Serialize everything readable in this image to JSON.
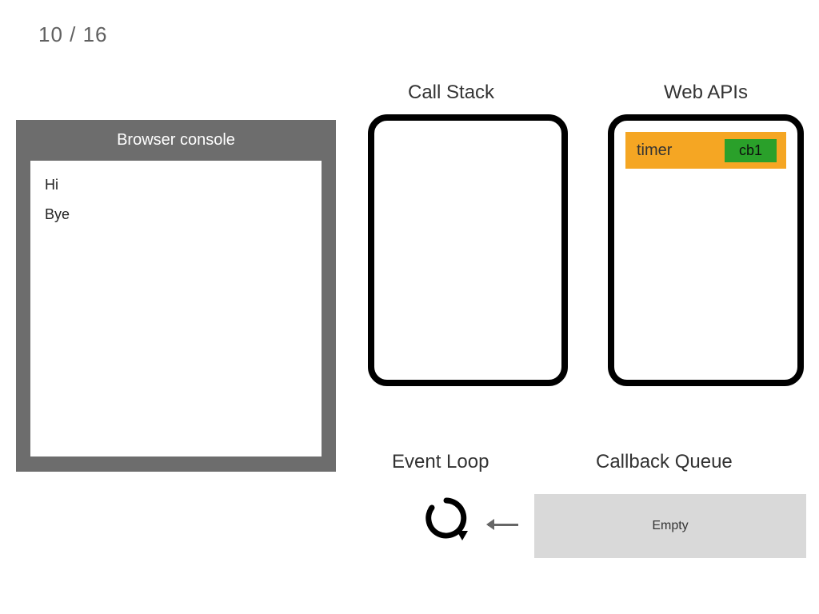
{
  "slide": {
    "counter": "10 / 16"
  },
  "console": {
    "title": "Browser console",
    "lines": [
      "Hi",
      "Bye"
    ]
  },
  "sections": {
    "callstack_title": "Call Stack",
    "webapis_title": "Web APIs",
    "eventloop_title": "Event Loop",
    "cbqueue_title": "Callback Queue"
  },
  "webapis": {
    "timer_label": "timer",
    "cb_label": "cb1"
  },
  "callback_queue": {
    "content": "Empty"
  }
}
